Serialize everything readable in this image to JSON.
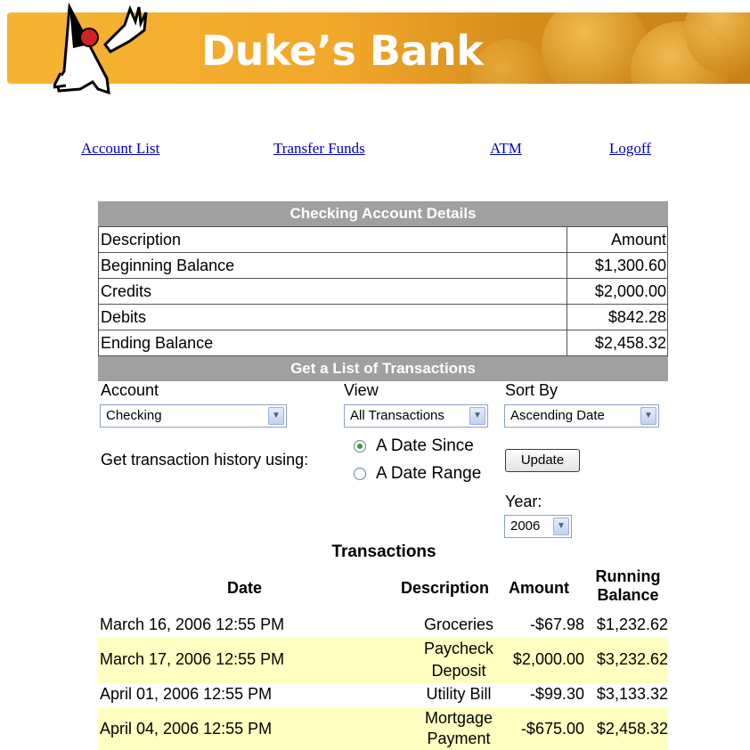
{
  "banner": {
    "title": "Duke’s Bank"
  },
  "nav": {
    "account_list": "Account List",
    "transfer_funds": "Transfer Funds",
    "atm": "ATM",
    "logoff": "Logoff"
  },
  "details": {
    "title": "Checking Account Details",
    "col_description": "Description",
    "col_amount": "Amount",
    "rows": [
      {
        "label": "Beginning Balance",
        "amount": "$1,300.60"
      },
      {
        "label": "Credits",
        "amount": "$2,000.00"
      },
      {
        "label": "Debits",
        "amount": "$842.28"
      },
      {
        "label": "Ending Balance",
        "amount": "$2,458.32"
      }
    ]
  },
  "transactions_form": {
    "title": "Get a List of Transactions",
    "account_label": "Account",
    "account_value": "Checking",
    "view_label": "View",
    "view_value": "All Transactions",
    "sort_label": "Sort By",
    "sort_value": "Ascending Date",
    "history_label": "Get transaction history using:",
    "radio_since": "A Date Since",
    "radio_range": "A Date Range",
    "update_button": "Update",
    "year_label": "Year:",
    "year_value": "2006"
  },
  "transactions": {
    "title": "Transactions",
    "headers": {
      "date": "Date",
      "description": "Description",
      "amount": "Amount",
      "running_1": "Running",
      "running_2": "Balance"
    },
    "rows": [
      {
        "date": "March 16, 2006 12:55 PM",
        "desc1": "Groceries",
        "desc2": "",
        "amount": "-$67.98",
        "balance": "$1,232.62"
      },
      {
        "date": "March 17, 2006 12:55 PM",
        "desc1": "Paycheck",
        "desc2": "Deposit",
        "amount": "$2,000.00",
        "balance": "$3,232.62"
      },
      {
        "date": "April 01, 2006 12:55 PM",
        "desc1": "Utility Bill",
        "desc2": "",
        "amount": "-$99.30",
        "balance": "$3,133.32"
      },
      {
        "date": "April 04, 2006 12:55 PM",
        "desc1": "Mortgage",
        "desc2": "Payment",
        "amount": "-$675.00",
        "balance": "$2,458.32"
      }
    ]
  },
  "colors": {
    "banner": "#f2a72a",
    "bar": "#a0a0a0",
    "row_highlight": "#ffffc2",
    "link": "#0000cc"
  }
}
